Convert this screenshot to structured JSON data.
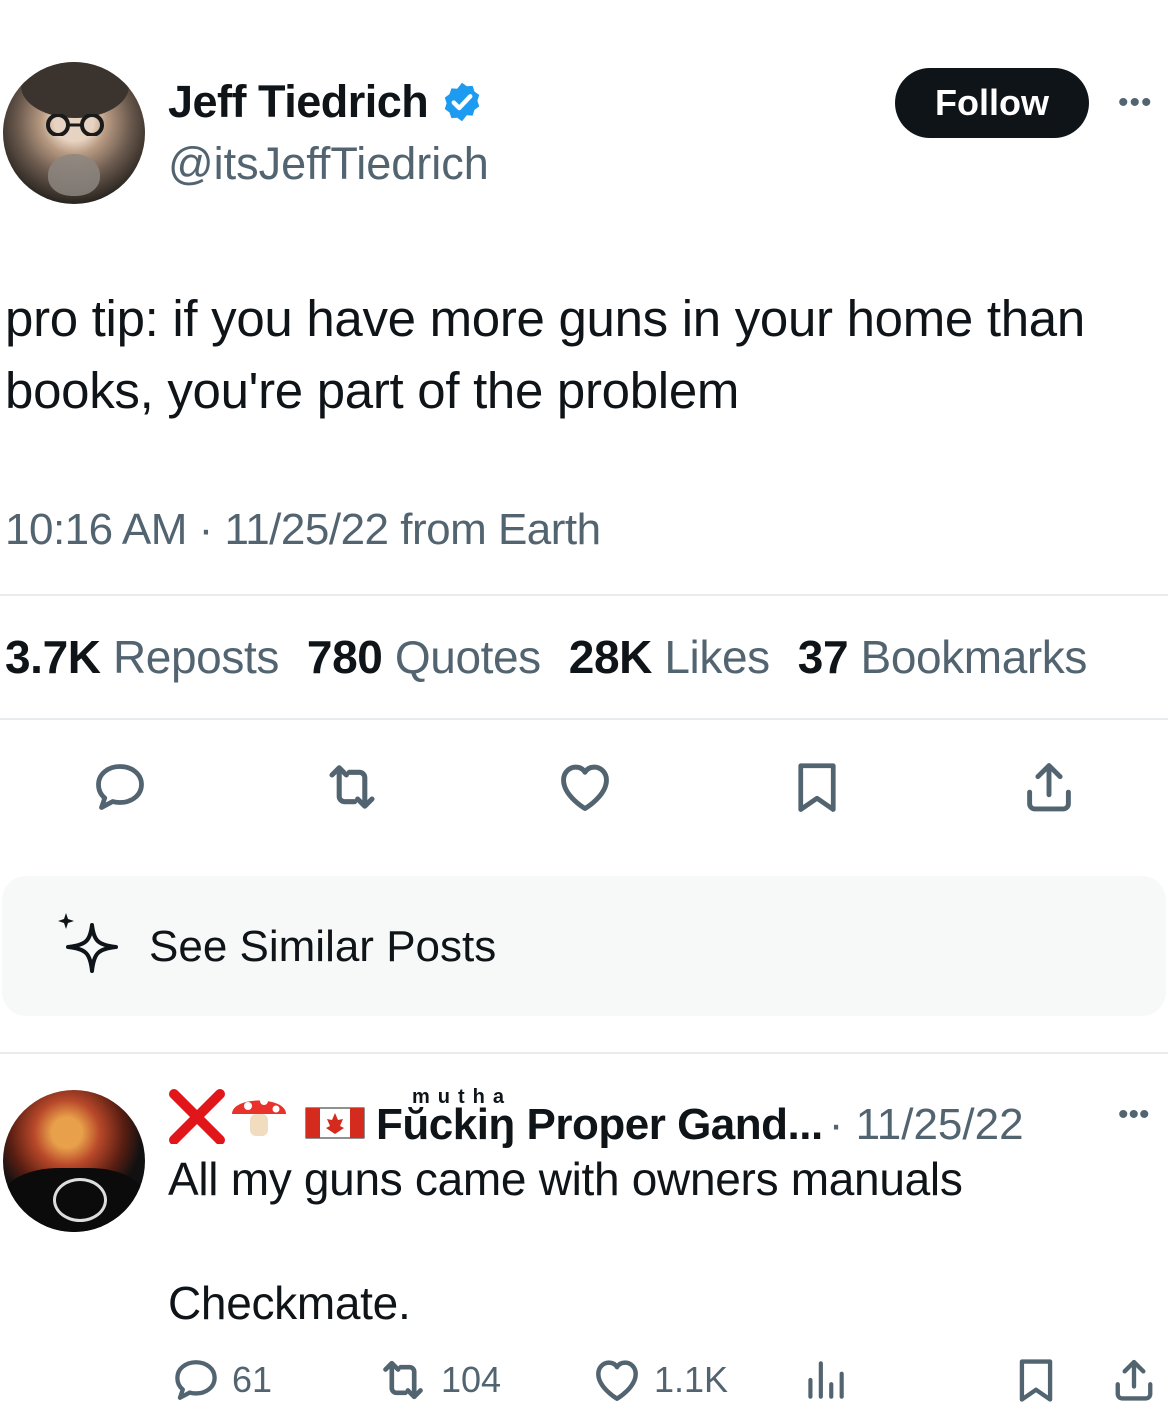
{
  "tweet": {
    "author_name": "Jeff Tiedrich",
    "handle": "@itsJeffTiedrich",
    "follow_label": "Follow",
    "more_icon": "more-horizontal-icon",
    "text": "pro tip: if you have more guns in your home than books, you're part of the problem",
    "timestamp": "10:16 AM · 11/25/22 from Earth",
    "stats": {
      "reposts_count": "3.7K",
      "reposts_label": "Reposts",
      "quotes_count": "780",
      "quotes_label": "Quotes",
      "likes_count": "28K",
      "likes_label": "Likes",
      "bookmarks_count": "37",
      "bookmarks_label": "Bookmarks"
    },
    "actions": [
      "reply-icon",
      "repost-icon",
      "like-icon",
      "bookmark-icon",
      "share-icon"
    ]
  },
  "similar_posts": {
    "label": "See Similar Posts",
    "icon": "sparkle-icon"
  },
  "reply": {
    "name_superscript": "mutha",
    "author_name": "Fŭckiŋ Proper Gand...",
    "date": "· 11/25/22",
    "text": "All my guns came with owners manuals\n\nCheckmate.",
    "replies": "61",
    "reposts": "104",
    "likes": "1.1K"
  },
  "colors": {
    "text": "#0f1419",
    "secondary": "#536471",
    "verified": "#1d9bf0",
    "divider": "#e8ecef"
  }
}
